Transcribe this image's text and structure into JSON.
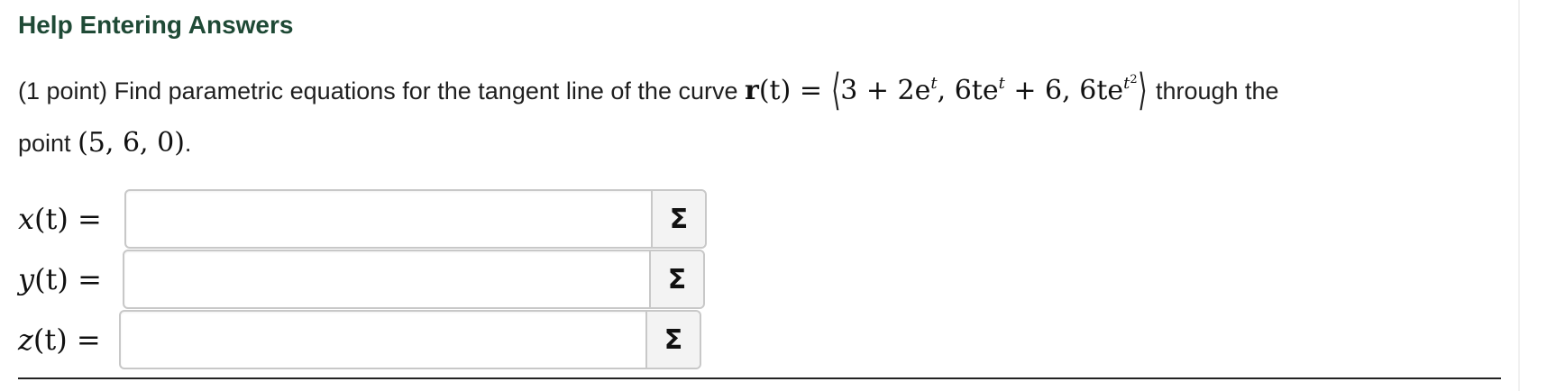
{
  "help_link": "Help Entering Answers",
  "problem": {
    "points": "(1 point)",
    "text_before": "Find parametric equations for the tangent line of the curve",
    "curve_name": "r",
    "curve_arg": "(t)",
    "equals": "=",
    "comp1": "3 + 2e",
    "comp1_exp": "t",
    "comp2": "6te",
    "comp2_exp": "t",
    "comp2_tail": " + 6,",
    "comp3": "6te",
    "comp3_exp": "t",
    "comp3_exp_exp": "2",
    "text_after": "through the",
    "point_word": "point",
    "point_value": "(5, 6, 0)",
    "period": "."
  },
  "answers": [
    {
      "fn": "x",
      "arg": "(t)",
      "eq": "=",
      "value": "",
      "button_icon": "sigma-icon"
    },
    {
      "fn": "y",
      "arg": "(t)",
      "eq": "=",
      "value": "",
      "button_icon": "sigma-icon"
    },
    {
      "fn": "z",
      "arg": "(t)",
      "eq": "=",
      "value": "",
      "button_icon": "sigma-icon"
    }
  ],
  "sigma_glyph": "Σ"
}
